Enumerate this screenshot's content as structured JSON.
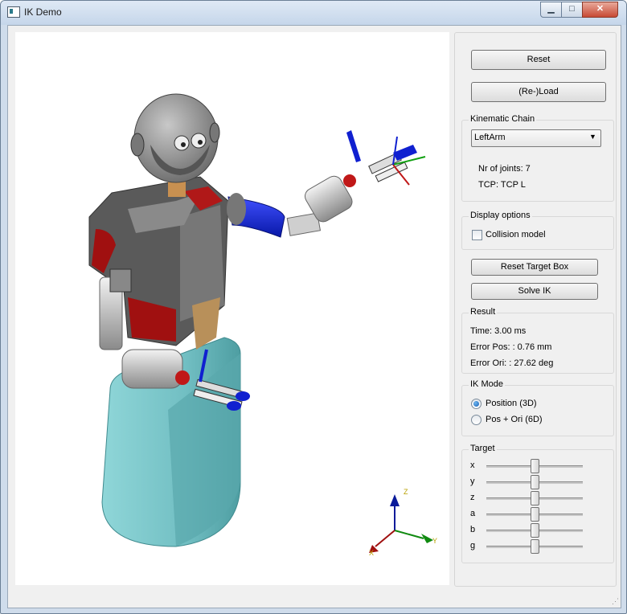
{
  "window": {
    "title": "IK Demo"
  },
  "controls": {
    "reset_label": "Reset",
    "reload_label": "(Re-)Load",
    "reset_target_box_label": "Reset Target Box",
    "solve_ik_label": "Solve IK"
  },
  "kinematic_chain": {
    "group_title": "Kinematic Chain",
    "selected": "LeftArm",
    "nr_joints": "Nr of joints: 7",
    "tcp": "TCP: TCP L"
  },
  "display_options": {
    "group_title": "Display options",
    "collision_model_label": "Collision model",
    "collision_model_checked": false
  },
  "result": {
    "group_title": "Result",
    "time": "Time: 3.00 ms",
    "error_pos": "Error Pos: : 0.76 mm",
    "error_ori": "Error Ori: : 27.62 deg"
  },
  "ik_mode": {
    "group_title": "IK Mode",
    "options": [
      {
        "label": "Position (3D)",
        "selected": true
      },
      {
        "label": "Pos + Ori (6D)",
        "selected": false
      }
    ]
  },
  "target": {
    "group_title": "Target",
    "sliders": [
      {
        "label": "x",
        "value": 0.5
      },
      {
        "label": "y",
        "value": 0.5
      },
      {
        "label": "z",
        "value": 0.5
      },
      {
        "label": "a",
        "value": 0.5
      },
      {
        "label": "b",
        "value": 0.5
      },
      {
        "label": "g",
        "value": 0.5
      }
    ]
  },
  "axes": {
    "x": "X",
    "y": "Y",
    "z": "Z"
  },
  "colors": {
    "body_teal": "#72bfc3",
    "torso_gray": "#5a5a5a",
    "torso_red": "#a01010",
    "arm_blue": "#1020d0",
    "head_gray": "#8a8a8a"
  }
}
